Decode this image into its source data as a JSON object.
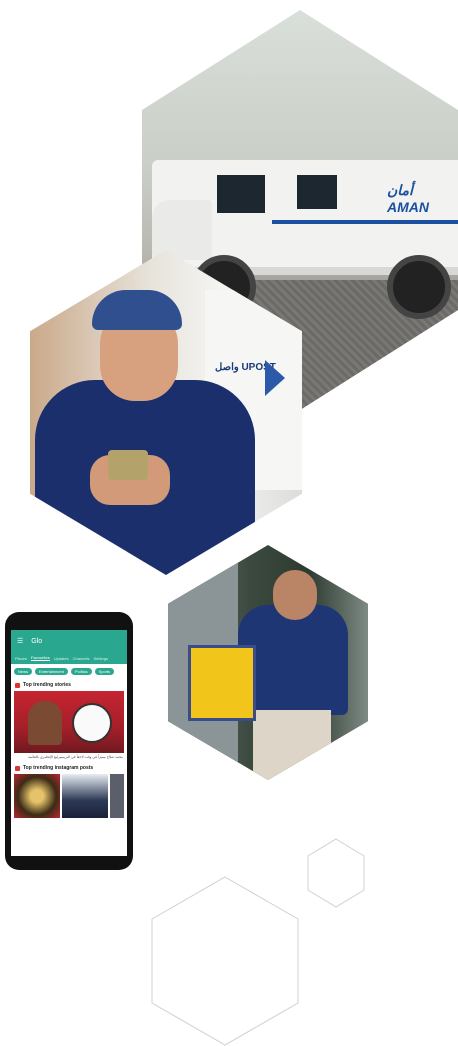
{
  "photos": {
    "van": {
      "subject": "armored-van",
      "logo_text": "أمان AMAN"
    },
    "courier": {
      "subject": "smiling-courier",
      "sign_text": "واصل UPOST"
    },
    "box_courier": {
      "subject": "courier-with-box"
    }
  },
  "phone_app": {
    "title": "Glo",
    "tabs": [
      "Places",
      "Favourites",
      "Updates",
      "Channels",
      "Settings"
    ],
    "active_tab": "Favourites",
    "chips": [
      "News",
      "Entertainment",
      "Politics",
      "Sports"
    ],
    "section_stories": "Top trending stories",
    "story_caption": "محمد صلاح مميزاً في وقت لاحقاً في البريمييرليغ الإنجليزي بالقائمة",
    "section_instagram": "Top trending instagram posts"
  },
  "colors": {
    "app_accent": "#2aa88f",
    "brand_blue": "#1b4fa0",
    "box_yellow": "#f1c519"
  }
}
